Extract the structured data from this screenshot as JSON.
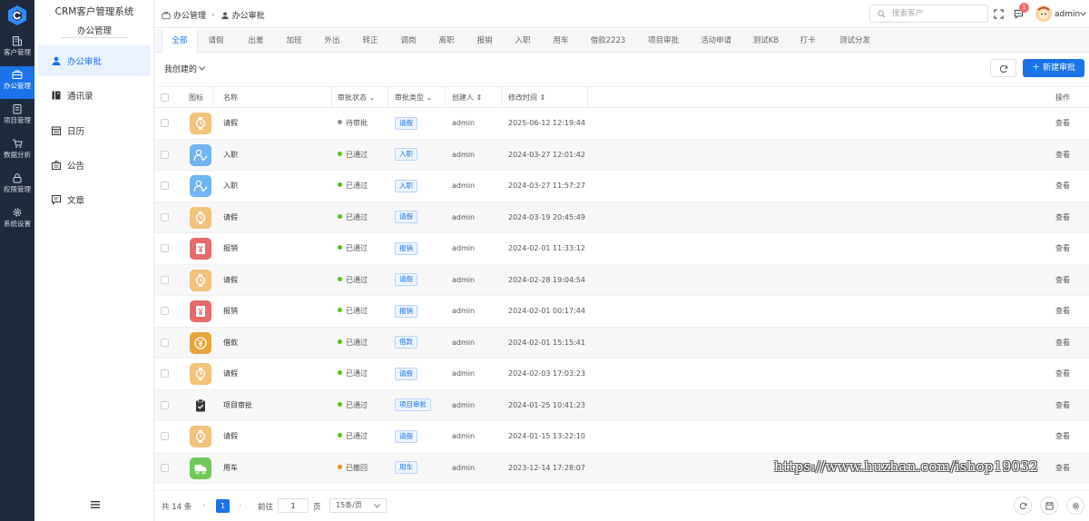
{
  "rail": {
    "items": [
      {
        "label": "客户管理",
        "icon": "building-icon"
      },
      {
        "label": "办公管理",
        "icon": "briefcase-icon"
      },
      {
        "label": "项目管理",
        "icon": "clipboard-icon"
      },
      {
        "label": "数据分析",
        "icon": "cart-icon"
      },
      {
        "label": "权限管理",
        "icon": "lock-icon"
      },
      {
        "label": "系统设置",
        "icon": "gear-icon"
      }
    ],
    "active_index": 1
  },
  "sidebar": {
    "app_title": "CRM客户管理系统",
    "app_subtitle": "办公管理",
    "items": [
      {
        "label": "办公审批",
        "icon": "user-icon"
      },
      {
        "label": "通讯录",
        "icon": "contacts-icon"
      },
      {
        "label": "日历",
        "icon": "calendar-icon"
      },
      {
        "label": "公告",
        "icon": "announcement-icon"
      },
      {
        "label": "文章",
        "icon": "message-icon"
      }
    ]
  },
  "header": {
    "breadcrumb": [
      "办公管理",
      "办公审批"
    ],
    "search_placeholder": "搜索客户",
    "notification_count": "1",
    "user_name": "admin"
  },
  "tabs": [
    "全部",
    "请假",
    "出差",
    "加班",
    "外出",
    "转正",
    "调岗",
    "离职",
    "报销",
    "入职",
    "用车",
    "借款2223",
    "项目审批",
    "活动申请",
    "测试KB",
    "打卡",
    "测试分发"
  ],
  "toolbar": {
    "filter_label": "我创建的",
    "new_button": "新建审批"
  },
  "table": {
    "columns": [
      "图标",
      "名称",
      "审批状态",
      "审批类型",
      "创建人",
      "修改时间",
      "操作"
    ],
    "rows": [
      {
        "name": "请假",
        "icon": "watch-icon",
        "status": "待审批",
        "type": "请假",
        "creator": "admin",
        "time": "2025-06-12 12:19:44",
        "action": "查看"
      },
      {
        "name": "入职",
        "icon": "onboarding-icon",
        "status": "已通过",
        "type": "入职",
        "creator": "admin",
        "time": "2024-03-27 12:01:42",
        "action": "查看"
      },
      {
        "name": "入职",
        "icon": "onboarding-icon",
        "status": "已通过",
        "type": "入职",
        "creator": "admin",
        "time": "2024-03-27 11:57:27",
        "action": "查看"
      },
      {
        "name": "请假",
        "icon": "watch-icon",
        "status": "已通过",
        "type": "请假",
        "creator": "admin",
        "time": "2024-03-19 20:45:49",
        "action": "查看"
      },
      {
        "name": "报销",
        "icon": "reimburse-icon",
        "status": "已通过",
        "type": "报销",
        "creator": "admin",
        "time": "2024-02-01 11:33:12",
        "action": "查看"
      },
      {
        "name": "请假",
        "icon": "watch-icon",
        "status": "已通过",
        "type": "请假",
        "creator": "admin",
        "time": "2024-02-28 19:04:54",
        "action": "查看"
      },
      {
        "name": "报销",
        "icon": "reimburse-icon",
        "status": "已通过",
        "type": "报销",
        "creator": "admin",
        "time": "2024-02-01 00:17:44",
        "action": "查看"
      },
      {
        "name": "借款",
        "icon": "coin-icon",
        "status": "已通过",
        "type": "借款",
        "creator": "admin",
        "time": "2024-02-01 15:15:41",
        "action": "查看"
      },
      {
        "name": "请假",
        "icon": "watch-icon",
        "status": "已通过",
        "type": "请假",
        "creator": "admin",
        "time": "2024-02-03 17:03:23",
        "action": "查看"
      },
      {
        "name": "项目审批",
        "icon": "clipboard-check-icon",
        "status": "已通过",
        "type": "项目审批",
        "creator": "admin",
        "time": "2024-01-25 10:41:23",
        "action": "查看"
      },
      {
        "name": "请假",
        "icon": "watch-icon",
        "status": "已通过",
        "type": "请假",
        "creator": "admin",
        "time": "2024-01-15 13:22:10",
        "action": "查看"
      },
      {
        "name": "用车",
        "icon": "truck-icon",
        "status": "已撤回",
        "type": "用车",
        "creator": "admin",
        "time": "2023-12-14 17:28:07",
        "action": "查看"
      }
    ]
  },
  "pagination": {
    "total_label": "共 14 条",
    "current_page": "1",
    "goto_label": "前往",
    "goto_value": "1",
    "page_unit": "页",
    "page_size": "15条/页"
  },
  "watermark": "https://www.huzhan.com/ishop19032",
  "colors": {
    "accent": "#1a73e8",
    "rail_bg": "#1f2a3f",
    "status_pending": "#8c8c8c",
    "status_approved": "#52c41a",
    "status_withdrawn": "#fa8c16"
  }
}
